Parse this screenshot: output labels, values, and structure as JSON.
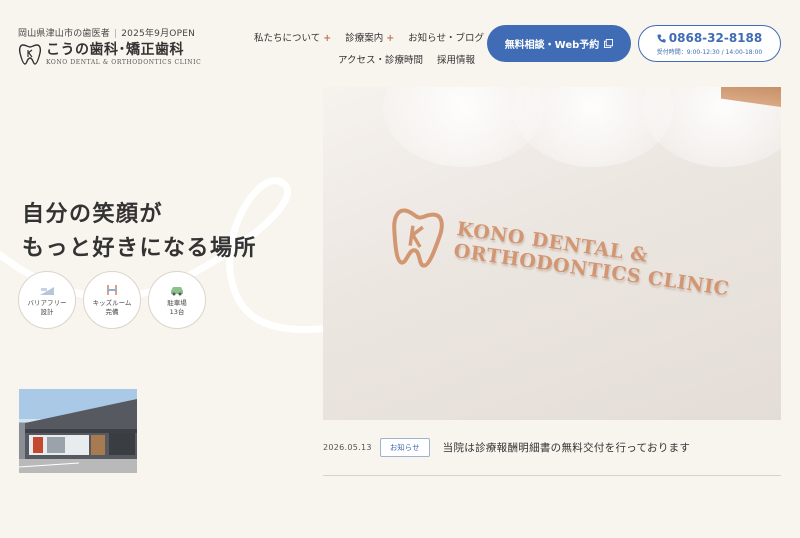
{
  "header": {
    "tagline_area": "岡山県津山市の歯医者",
    "tagline_open": "2025年9月OPEN",
    "logo_name": "こうの歯科･矯正歯科",
    "logo_en": "KONO DENTAL & ORTHODONTICS CLINIC"
  },
  "nav": {
    "row1": [
      "私たちについて",
      "診療案内",
      "お知らせ・ブログ"
    ],
    "row1_plus": [
      "+",
      "+",
      ""
    ],
    "row2": [
      "アクセス・診療時間",
      "採用情報"
    ]
  },
  "cta": {
    "reserve_label": "無料相談・Web予約",
    "tel_number": "0868-32-8188",
    "tel_hours": "受付時間：9:00-12:30 / 14:00-18:00"
  },
  "hero": {
    "title_line1": "自分の笑顔が",
    "title_line2": "もっと好きになる場所",
    "sign_line1": "KONO DENTAL &",
    "sign_line2": "ORTHODONTICS CLINIC"
  },
  "badges": [
    {
      "icon": "barrier-free-icon",
      "line1": "バリアフリー",
      "line2": "設計"
    },
    {
      "icon": "kids-room-icon",
      "line1": "キッズルーム",
      "line2": "完備"
    },
    {
      "icon": "parking-car-icon",
      "line1": "駐車場",
      "line2": "13台"
    }
  ],
  "news": {
    "date": "2026.05.13",
    "category": "お知らせ",
    "title": "当院は診療報酬明細書の無料交付を行っております"
  },
  "colors": {
    "background": "#f8f4ee",
    "accent_blue": "#3f6cb4",
    "sign_copper": "#d29672"
  }
}
